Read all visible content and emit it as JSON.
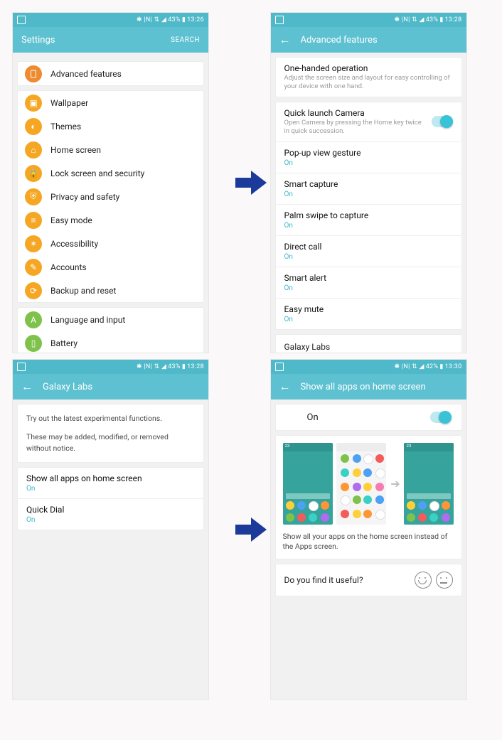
{
  "statusbar": {
    "battery43": "43%",
    "battery42": "42%",
    "time1": "13:26",
    "time2": "13:28",
    "time3": "13:28",
    "time4": "13:30",
    "icons": "✱ |N| ⇅ ◢"
  },
  "screen1": {
    "title": "Settings",
    "search": "SEARCH",
    "featured": {
      "label": "Advanced features"
    },
    "groupA": [
      {
        "label": "Wallpaper"
      },
      {
        "label": "Themes"
      },
      {
        "label": "Home screen"
      },
      {
        "label": "Lock screen and security"
      },
      {
        "label": "Privacy and safety"
      },
      {
        "label": "Easy mode"
      },
      {
        "label": "Accessibility"
      },
      {
        "label": "Accounts"
      },
      {
        "label": "Backup and reset"
      }
    ],
    "groupB": [
      {
        "label": "Language and input"
      },
      {
        "label": "Battery"
      }
    ]
  },
  "screen2": {
    "title": "Advanced features",
    "topItem": {
      "title": "One-handed operation",
      "sub": "Adjust the screen size and layout for easy controlling of your device with one hand."
    },
    "toggleItem": {
      "title": "Quick launch Camera",
      "sub": "Open Camera by pressing the Home key twice in quick succession."
    },
    "items": [
      {
        "title": "Pop-up view gesture",
        "status": "On"
      },
      {
        "title": "Smart capture",
        "status": "On"
      },
      {
        "title": "Palm swipe to capture",
        "status": "On"
      },
      {
        "title": "Direct call",
        "status": "On"
      },
      {
        "title": "Smart alert",
        "status": "On"
      },
      {
        "title": "Easy mute",
        "status": "On"
      }
    ],
    "last": {
      "title": "Galaxy Labs"
    }
  },
  "screen3": {
    "title": "Galaxy Labs",
    "intro1": "Try out the latest experimental functions.",
    "intro2": "These may be added, modified, or removed without notice.",
    "items": [
      {
        "title": "Show all apps on home screen",
        "status": "On"
      },
      {
        "title": "Quick Dial",
        "status": "On"
      }
    ]
  },
  "screen4": {
    "title": "Show all apps on home screen",
    "toggleLabel": "On",
    "caption": "Show all your apps on the home screen instead of the Apps screen.",
    "feedback": "Do you find it useful?",
    "temp": "23"
  }
}
